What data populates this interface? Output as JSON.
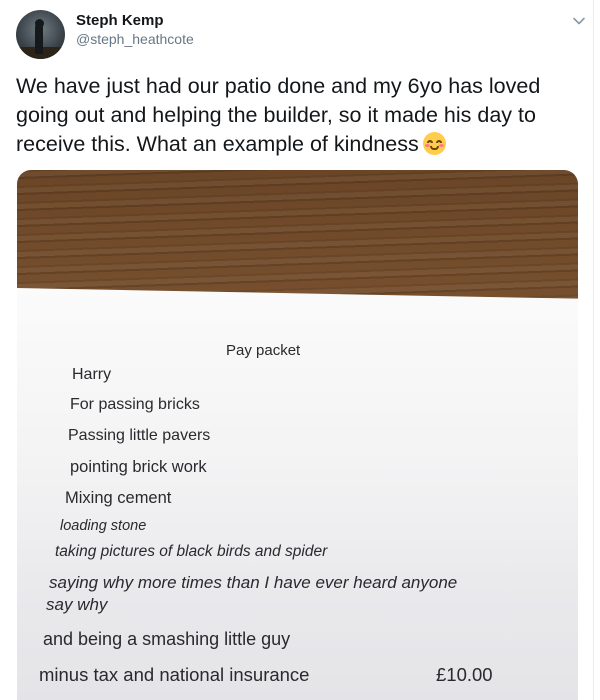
{
  "author": {
    "name": "Steph Kemp",
    "handle": "@steph_heathcote"
  },
  "icons": {
    "menu": "chevron-down-icon",
    "emoji": "smiling-face-with-smiling-eyes-icon"
  },
  "tweet": {
    "text": "We have just had our patio done and my 6yo has loved going out and helping the builder, so it made his day to receive this. What an example of kindness"
  },
  "note": {
    "title": "Pay packet",
    "lines": [
      "Harry",
      "For passing bricks",
      "Passing little pavers",
      "pointing brick work",
      "Mixing cement",
      "loading stone",
      "taking pictures of black birds and spider",
      "saying why more times than I have ever heard anyone",
      "say why",
      "and being a smashing little guy",
      "minus tax and national insurance"
    ],
    "amount": "£10.00"
  },
  "colors": {
    "text": "#14171a",
    "secondary": "#657786",
    "border": "#e6ecf0"
  }
}
